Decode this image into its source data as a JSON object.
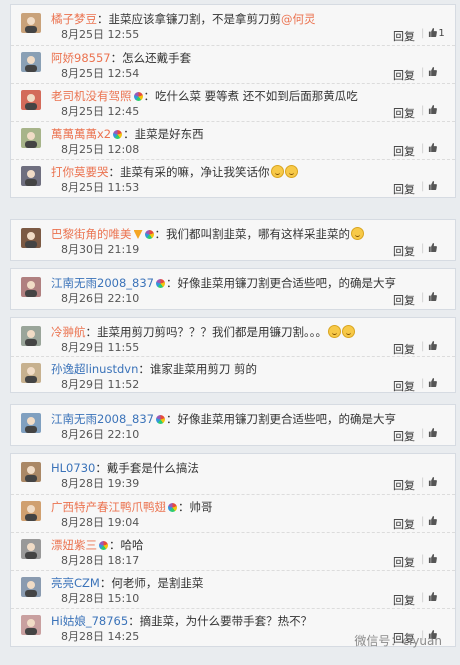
{
  "reply_label": "回复",
  "like_icon": "thumbs-up-icon",
  "panels": [
    {
      "comments": [
        {
          "user": "橘子梦豆",
          "user_color": "#eb7350",
          "text": "：韭菜应该拿镰刀割，不是拿剪刀剪",
          "mention": "@何灵",
          "time": "8月25日 12:55",
          "likes": "1",
          "emoji": 0,
          "badge": false
        },
        {
          "user": "阿娇98557",
          "user_color": "#eb7350",
          "text": "：怎么还戴手套",
          "mention": "",
          "time": "8月25日 12:54",
          "likes": "",
          "emoji": 0,
          "badge": false
        },
        {
          "user": "老司机没有驾照",
          "user_color": "#eb7350",
          "text": "：吃什么菜 要等煮 还不如到后面那黄瓜吃",
          "mention": "",
          "time": "8月25日 12:45",
          "likes": "",
          "emoji": 0,
          "badge": true
        },
        {
          "user": "萬萬萬萬x2",
          "user_color": "#eb7350",
          "text": "：韭菜是好东西",
          "mention": "",
          "time": "8月25日 12:08",
          "likes": "",
          "emoji": 0,
          "badge": true
        },
        {
          "user": "打你莫要哭",
          "user_color": "#eb7350",
          "text": "：韭菜有采的嘛，净让我笑话你",
          "mention": "",
          "time": "8月25日 11:53",
          "likes": "",
          "emoji": 2,
          "badge": false
        }
      ]
    },
    {
      "comments": [
        {
          "user": "巴黎街角的唯美",
          "user_color": "#eb7350",
          "text": "：我们都叫割韭菜，哪有这样采韭菜的",
          "mention": "",
          "time": "8月30日 21:19",
          "likes": "",
          "emoji": 1,
          "badge": true,
          "vip": true
        }
      ]
    },
    {
      "comments": [
        {
          "user": "江南无雨2008_837",
          "user_color": "#3b73b9",
          "text": "：好像韭菜用镰刀割更合适些吧，的确是大亨",
          "mention": "",
          "time": "8月26日 22:10",
          "likes": "",
          "emoji": 0,
          "badge": true
        }
      ]
    },
    {
      "comments": [
        {
          "user": "冷翀航",
          "user_color": "#eb7350",
          "text": "：韭菜用剪刀剪吗？？？我们都是用镰刀割。。。",
          "mention": "",
          "time": "8月29日 11:55",
          "likes": "",
          "emoji": 2,
          "badge": false
        },
        {
          "user": "孙逸超linustdvn",
          "user_color": "#3b73b9",
          "text": "：谁家韭菜用剪刀 剪的",
          "mention": "",
          "time": "8月29日 11:52",
          "likes": "",
          "emoji": 0,
          "badge": false
        }
      ]
    },
    {
      "comments": [
        {
          "user": "江南无雨2008_837",
          "user_color": "#3b73b9",
          "text": "：好像韭菜用镰刀割更合适些吧，的确是大亨",
          "mention": "",
          "time": "8月26日 22:10",
          "likes": "",
          "emoji": 0,
          "badge": true
        }
      ]
    },
    {
      "comments": [
        {
          "user": "HL0730",
          "user_color": "#3b73b9",
          "text": "：戴手套是什么搞法",
          "mention": "",
          "time": "8月28日 19:39",
          "likes": "",
          "emoji": 0,
          "badge": false
        },
        {
          "user": "广西特产春江鸭爪鸭翅",
          "user_color": "#eb7350",
          "text": "：帅哥",
          "mention": "",
          "time": "8月28日 19:04",
          "likes": "",
          "emoji": 0,
          "badge": true
        },
        {
          "user": "漂妞紫三",
          "user_color": "#eb7350",
          "text": "：哈哈",
          "mention": "",
          "time": "8月28日 18:17",
          "likes": "",
          "emoji": 0,
          "badge": true
        },
        {
          "user": "亮亮CZM",
          "user_color": "#3b73b9",
          "text": "：何老师，是割韭菜",
          "mention": "",
          "time": "8月28日 15:10",
          "likes": "",
          "emoji": 0,
          "badge": false
        },
        {
          "user": "Hi姑娘_78765",
          "user_color": "#3b73b9",
          "text": "：摘韭菜，为什么要带手套？热不？",
          "mention": "",
          "time": "8月28日 14:25",
          "likes": "",
          "emoji": 0,
          "badge": false
        }
      ]
    }
  ],
  "watermark": "微信号：ciyuan"
}
